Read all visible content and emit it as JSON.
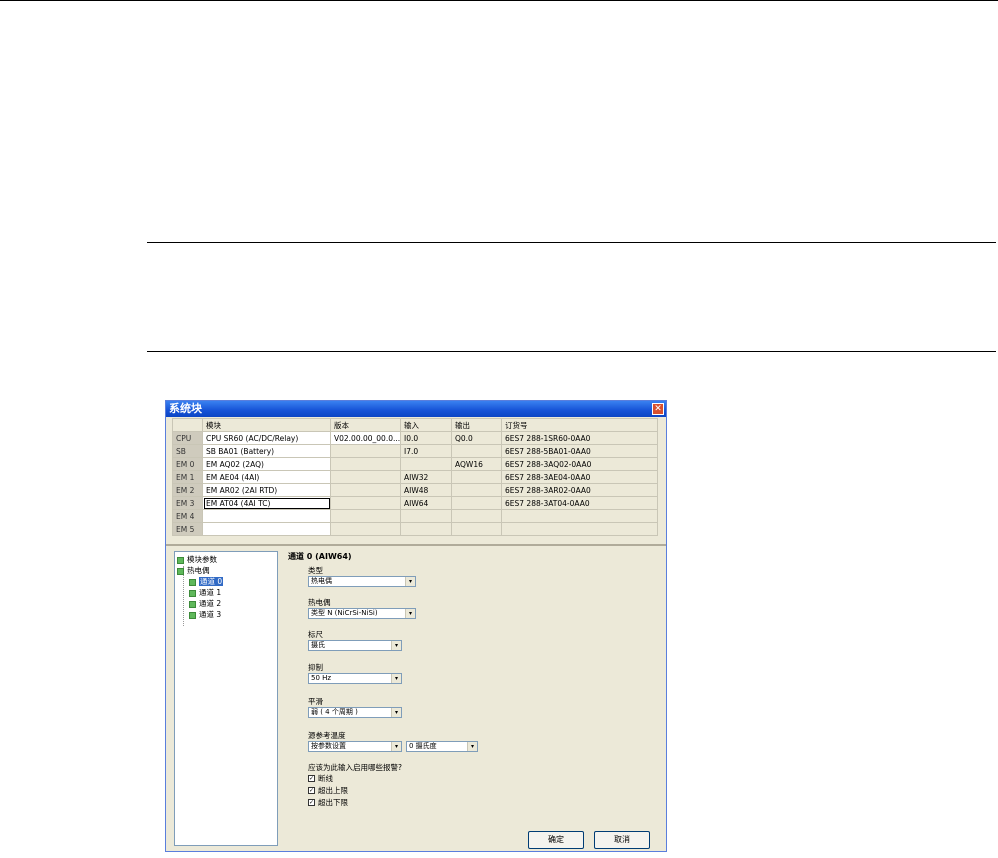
{
  "dialog": {
    "title": "系统块",
    "columns": [
      "",
      "模块",
      "版本",
      "输入",
      "输出",
      "订货号"
    ],
    "rows": [
      {
        "slot": "CPU",
        "module": "CPU SR60 (AC/DC/Relay)",
        "version": "V02.00.00_00.0...",
        "input": "I0.0",
        "output": "Q0.0",
        "order": "6ES7 288-1SR60-0AA0"
      },
      {
        "slot": "SB",
        "module": "SB BA01 (Battery)",
        "version": "",
        "input": "I7.0",
        "output": "",
        "order": "6ES7 288-5BA01-0AA0"
      },
      {
        "slot": "EM 0",
        "module": "EM AQ02 (2AQ)",
        "version": "",
        "input": "",
        "output": "AQW16",
        "order": "6ES7 288-3AQ02-0AA0"
      },
      {
        "slot": "EM 1",
        "module": "EM AE04 (4AI)",
        "version": "",
        "input": "AIW32",
        "output": "",
        "order": "6ES7 288-3AE04-0AA0"
      },
      {
        "slot": "EM 2",
        "module": "EM AR02 (2AI RTD)",
        "version": "",
        "input": "AIW48",
        "output": "",
        "order": "6ES7 288-3AR02-0AA0"
      },
      {
        "slot": "EM 3",
        "module": "EM AT04 (4AI TC)",
        "version": "",
        "input": "AIW64",
        "output": "",
        "order": "6ES7 288-3AT04-0AA0"
      },
      {
        "slot": "EM 4",
        "module": "",
        "version": "",
        "input": "",
        "output": "",
        "order": ""
      },
      {
        "slot": "EM 5",
        "module": "",
        "version": "",
        "input": "",
        "output": "",
        "order": ""
      }
    ],
    "tree": {
      "module_params": "模块参数",
      "thermocouple": "热电偶",
      "channels": [
        "通道 0",
        "通道 1",
        "通道 2",
        "通道 3"
      ]
    },
    "panel": {
      "title": "通道 0 (AIW64)",
      "type_label": "类型",
      "type_value": "热电偶",
      "tc_label": "热电偶",
      "tc_value": "类型 N (NiCrSi-NiSi)",
      "scale_label": "标尺",
      "scale_value": "摄氏",
      "reject_label": "抑制",
      "reject_value": "50 Hz",
      "smooth_label": "平滑",
      "smooth_value": "弱 ( 4 个周期 )",
      "cjc_label": "源参考温度",
      "cjc_value": "按参数设置",
      "cjc_temp_value": "0 摄氏度",
      "alarm_question": "应该为此输入启用哪些报警?",
      "alarms": [
        "断线",
        "超出上限",
        "超出下限"
      ]
    },
    "ok_label": "确定",
    "cancel_label": "取消"
  }
}
